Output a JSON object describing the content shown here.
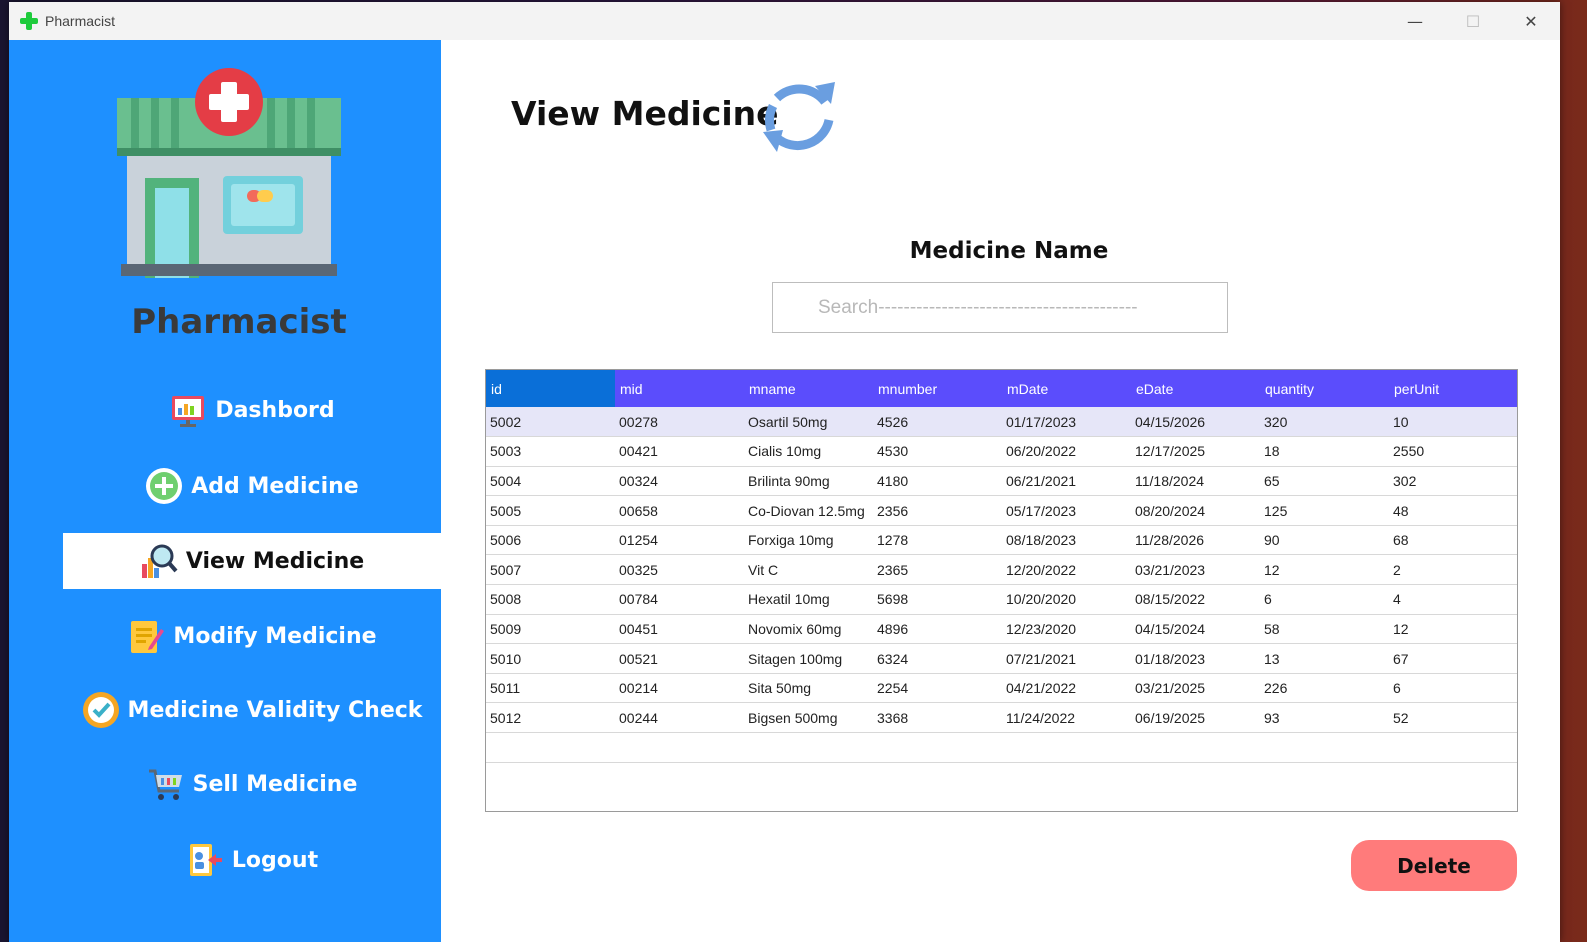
{
  "window": {
    "title": "Pharmacist",
    "controls": {
      "minimize": "—",
      "maximize": "☐",
      "close": "✕"
    }
  },
  "sidebar": {
    "brand": "Pharmacist",
    "items": [
      {
        "label": "Dashbord",
        "icon": "dashboard-icon",
        "active": false
      },
      {
        "label": "Add Medicine",
        "icon": "add-icon",
        "active": false
      },
      {
        "label": "View Medicine",
        "icon": "magnifier-chart-icon",
        "active": true
      },
      {
        "label": "Modify Medicine",
        "icon": "edit-document-icon",
        "active": false
      },
      {
        "label": "Medicine Validity Check",
        "icon": "check-badge-icon",
        "active": false
      },
      {
        "label": "Sell Medicine",
        "icon": "cart-icon",
        "active": false
      },
      {
        "label": "Logout",
        "icon": "logout-icon",
        "active": false
      }
    ]
  },
  "main": {
    "title": "View Medicine",
    "search": {
      "label": "Medicine Name",
      "placeholder": "Search-----------------------------------------",
      "value": ""
    },
    "table": {
      "columns": [
        "id",
        "mid",
        "mname",
        "mnumber",
        "mDate",
        "eDate",
        "quantity",
        "perUnit"
      ],
      "rows": [
        [
          "5002",
          "00278",
          "Osartil 50mg",
          "4526",
          "01/17/2023",
          "04/15/2026",
          "320",
          "10"
        ],
        [
          "5003",
          "00421",
          "Cialis 10mg",
          "4530",
          "06/20/2022",
          "12/17/2025",
          "18",
          "2550"
        ],
        [
          "5004",
          "00324",
          "Brilinta 90mg",
          "4180",
          "06/21/2021",
          "11/18/2024",
          "65",
          "302"
        ],
        [
          "5005",
          "00658",
          "Co-Diovan 12.5mg",
          "2356",
          "05/17/2023",
          "08/20/2024",
          "125",
          "48"
        ],
        [
          "5006",
          "01254",
          "Forxiga 10mg",
          "1278",
          "08/18/2023",
          "11/28/2026",
          "90",
          "68"
        ],
        [
          "5007",
          "00325",
          "Vit C",
          "2365",
          "12/20/2022",
          "03/21/2023",
          "12",
          "2"
        ],
        [
          "5008",
          "00784",
          "Hexatil 10mg",
          "5698",
          "10/20/2020",
          "08/15/2022",
          "6",
          "4"
        ],
        [
          "5009",
          "00451",
          "Novomix 60mg",
          "4896",
          "12/23/2020",
          "04/15/2024",
          "58",
          "12"
        ],
        [
          "5010",
          "00521",
          "Sitagen 100mg",
          "6324",
          "07/21/2021",
          "01/18/2023",
          "13",
          "67"
        ],
        [
          "5011",
          "00214",
          "Sita 50mg",
          "2254",
          "04/21/2022",
          "03/21/2025",
          "226",
          "6"
        ],
        [
          "5012",
          "00244",
          "Bigsen 500mg",
          "3368",
          "11/24/2022",
          "06/19/2025",
          "93",
          "52"
        ]
      ],
      "selected_row": 0
    },
    "delete_label": "Delete"
  },
  "colors": {
    "sidebar": "#1e90ff",
    "header": "#5b4dfc",
    "header_first": "#0a6fd8",
    "delete": "#ff7b7b",
    "selected_row": "#e6e6f8"
  }
}
